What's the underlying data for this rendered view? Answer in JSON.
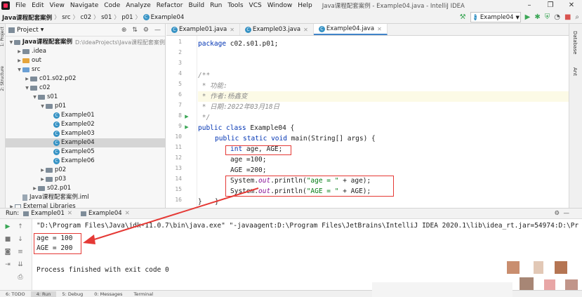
{
  "menu": {
    "items": [
      "File",
      "Edit",
      "View",
      "Navigate",
      "Code",
      "Analyze",
      "Refactor",
      "Build",
      "Run",
      "Tools",
      "VCS",
      "Window",
      "Help"
    ],
    "window_title": "Java课程配套案例 - Example04.java - IntelliJ IDEA",
    "minimize": "–",
    "restore": "❐",
    "close": "✕"
  },
  "navbar": {
    "crumbs": [
      "Java课程配套案例",
      "src",
      "c02",
      "s01",
      "p01",
      "Example04"
    ],
    "run_config": "Example04"
  },
  "left_stripe": {
    "labels": [
      "1: Project",
      "2: Structure"
    ]
  },
  "project": {
    "title": "Project",
    "tree": [
      {
        "label": "Java课程配套案例",
        "path": "D:\\IdeaProjects\\Java课程配套案例",
        "indent": 0,
        "arrow": "▼",
        "type": "module"
      },
      {
        "label": ".idea",
        "indent": 1,
        "arrow": "▶",
        "type": "folder"
      },
      {
        "label": "out",
        "indent": 1,
        "arrow": "▶",
        "type": "folder-orange"
      },
      {
        "label": "src",
        "indent": 1,
        "arrow": "▼",
        "type": "folder-blue"
      },
      {
        "label": "c01.s02.p02",
        "indent": 2,
        "arrow": "▶",
        "type": "folder"
      },
      {
        "label": "c02",
        "indent": 2,
        "arrow": "▼",
        "type": "folder"
      },
      {
        "label": "s01",
        "indent": 3,
        "arrow": "▼",
        "type": "folder"
      },
      {
        "label": "p01",
        "indent": 4,
        "arrow": "▼",
        "type": "folder"
      },
      {
        "label": "Example01",
        "indent": 5,
        "arrow": "",
        "type": "class"
      },
      {
        "label": "Example02",
        "indent": 5,
        "arrow": "",
        "type": "class"
      },
      {
        "label": "Example03",
        "indent": 5,
        "arrow": "",
        "type": "class"
      },
      {
        "label": "Example04",
        "indent": 5,
        "arrow": "",
        "type": "class",
        "selected": true
      },
      {
        "label": "Example05",
        "indent": 5,
        "arrow": "",
        "type": "class"
      },
      {
        "label": "Example06",
        "indent": 5,
        "arrow": "",
        "type": "class"
      },
      {
        "label": "p02",
        "indent": 4,
        "arrow": "▶",
        "type": "folder"
      },
      {
        "label": "p03",
        "indent": 4,
        "arrow": "▶",
        "type": "folder"
      },
      {
        "label": "s02.p01",
        "indent": 3,
        "arrow": "▶",
        "type": "folder"
      },
      {
        "label": "Java课程配套案例.iml",
        "indent": 1,
        "arrow": "",
        "type": "file"
      },
      {
        "label": "External Libraries",
        "indent": 0,
        "arrow": "▶",
        "type": "lib"
      }
    ]
  },
  "editor": {
    "tabs": [
      "Example01.java",
      "Example03.java",
      "Example04.java"
    ],
    "active_tab": 2,
    "line_numbers": [
      "1",
      "2",
      "3",
      "4",
      "5",
      "6",
      "7",
      "8",
      "9",
      "10",
      "11",
      "12",
      "13",
      "14",
      "15",
      "16"
    ]
  },
  "code": {
    "l1_kw": "package",
    "l1_rest": " c02.s01.p01;",
    "l3": "/**",
    "l4": " * 功能:",
    "l5": " * 作者:杨鑫变",
    "l6": " * 日期:2022年03月18日",
    "l7": " */",
    "l8_kw": "public class",
    "l8_rest": " Example04 {",
    "l9_kw": "public static void",
    "l9_rest": " main(String[] args) {",
    "l10_kw": "int",
    "l10_rest": " age, AGE;",
    "l11": "age =100;",
    "l12": "AGE =200;",
    "l13_a": "System.",
    "l13_b": "out",
    "l13_c": ".println(",
    "l13_d": "\"age = \"",
    "l13_e": " + age);",
    "l14_a": "System.",
    "l14_b": "out",
    "l14_c": ".println(",
    "l14_d": "\"AGE = \"",
    "l14_e": " + AGE);",
    "l15": "}",
    "l16": "}"
  },
  "right_stripe": {
    "labels": [
      "Database",
      "Ant"
    ]
  },
  "run": {
    "label": "Run:",
    "tabs": [
      "Example01",
      "Example04"
    ],
    "cmd": "\"D:\\Program Files\\Java\\jdk-11.0.7\\bin\\java.exe\" \"-javaagent:D:\\Program Files\\JetBrains\\IntelliJ IDEA 2020.1\\lib\\idea_rt.jar=54974:D:\\Pr",
    "out1": "age = 100",
    "out2": "AGE = 200",
    "finish": "Process finished with exit code 0"
  },
  "bottom": {
    "items": [
      "6: TODO",
      "4: Run",
      "5: Debug",
      "0: Messages",
      "Terminal"
    ]
  },
  "colors": {
    "annotation": "#e53935",
    "keyword": "#0033b3",
    "string": "#067d17",
    "comment": "#8c8c8c"
  }
}
